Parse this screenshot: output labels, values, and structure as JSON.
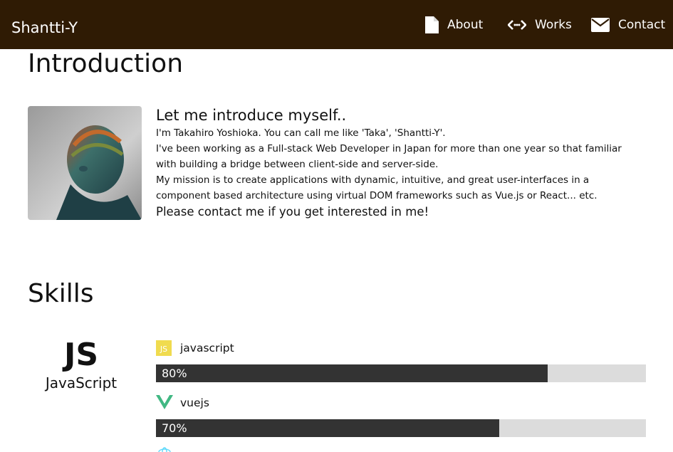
{
  "header": {
    "brand": "Shantti-Y",
    "nav": [
      {
        "label": "About",
        "icon": "document-icon"
      },
      {
        "label": "Works",
        "icon": "code-arrows-icon"
      },
      {
        "label": "Contact",
        "icon": "envelope-icon"
      }
    ]
  },
  "intro": {
    "title": "Introduction",
    "heading": "Let me introduce myself..",
    "lines": [
      "I'm Takahiro Yoshioka. You can call me like 'Taka', 'Shantti-Y'.",
      "I've been working as a Full-stack Web Developer in Japan for more than one year so that familiar",
      "with building a bridge between client-side and server-side.",
      "My mission is to create applications with dynamic, intuitive, and great user-interfaces in a",
      "component based architecture using virtual DOM frameworks such as Vue.js or React... etc."
    ],
    "cta": "Please contact me if you get interested in me!"
  },
  "skills": {
    "title": "Skills",
    "card": {
      "logo": "JS",
      "name": "JavaScript"
    },
    "items": [
      {
        "name": "javascript",
        "icon": "js-icon",
        "percent": 80,
        "percent_label": "80%",
        "color": "#f0db4f"
      },
      {
        "name": "vuejs",
        "icon": "vue-icon",
        "percent": 70,
        "percent_label": "70%",
        "color": "#41b883"
      }
    ]
  },
  "colors": {
    "header_bg": "#2f1b04",
    "bar_fill": "#333333",
    "bar_track": "#dcdcdc"
  }
}
